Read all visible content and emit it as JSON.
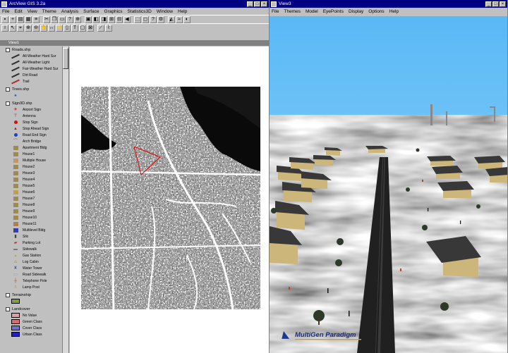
{
  "left_window": {
    "title": "ArcView GIS 3.2a",
    "menu": [
      "File",
      "Edit",
      "View",
      "Theme",
      "Analysis",
      "Surface",
      "Graphics",
      "Statistics3D",
      "Window",
      "Help"
    ]
  },
  "doc_window": {
    "title": "View1"
  },
  "toc": {
    "themes": [
      {
        "name": "Roads.shp",
        "items": [
          "All-Weather Hard Sur",
          "All-Weather Light",
          "Fair-Weather Hard Sur",
          "Dirt Road",
          "Trail"
        ]
      },
      {
        "name": "Trees.shp",
        "items": []
      },
      {
        "name": "Sign3D.shp",
        "items": [
          "Airport Sign",
          "Antenna",
          "Stop Sign",
          "Stop Ahead Sign",
          "Road End Sign",
          "Arch Bridge",
          "Apartment Bldg",
          "House1",
          "Multiple House",
          "House2",
          "House3",
          "House4",
          "House5",
          "House6",
          "House7",
          "House8",
          "House9",
          "House10",
          "House11",
          "Multilevel Bldg",
          "Silo",
          "Parking Lot",
          "Sidewalk",
          "Gas Station",
          "Log Cabin",
          "Water Tower",
          "Road Sidewalk",
          "Telephone Pole",
          "Lamp Post"
        ]
      },
      {
        "name": "Terrainship",
        "items": []
      },
      {
        "name": "Landcover",
        "items": [
          "No Value",
          "Green Class",
          "Cover Class",
          "Urban Class"
        ]
      }
    ]
  },
  "right_window": {
    "title": "View3",
    "menu": [
      "File",
      "Themes",
      "Model",
      "EyePoints",
      "Display",
      "Options",
      "Help"
    ],
    "logo_text": "MultiGen Paradigm"
  },
  "colors": {
    "titlebar": "#000080",
    "sky": "#5bb8f5",
    "house_wall": "#cdb67a",
    "house_roof": "#383838",
    "road": "#202020"
  }
}
